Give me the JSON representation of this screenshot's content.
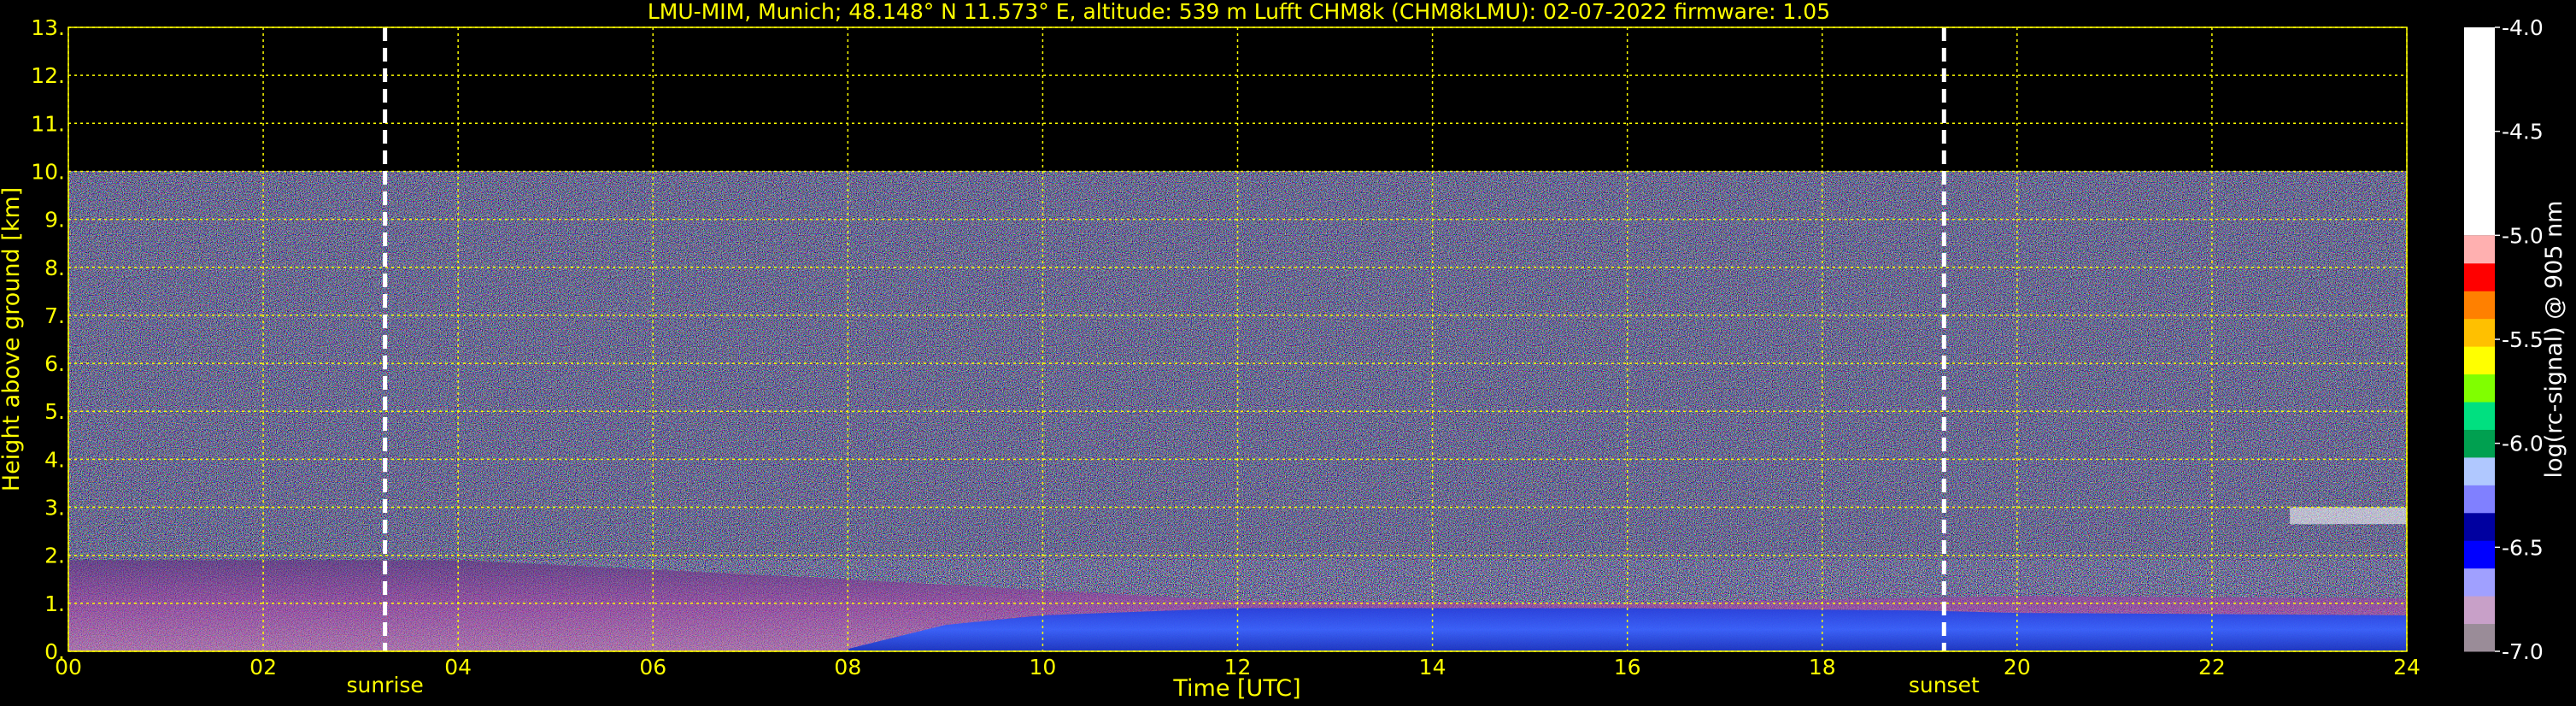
{
  "chart_data": {
    "type": "heatmap",
    "title": "LMU-MIM, Munich; 48.148° N 11.573° E, altitude: 539 m    Lufft CHM8k (CHM8kLMU): 02-07-2022    firmware: 1.05",
    "xlabel": "Time [UTC]",
    "ylabel": "Height above ground [km]",
    "xlim": [
      0,
      24
    ],
    "ylim": [
      0,
      13
    ],
    "x_ticks": [
      "00",
      "02",
      "04",
      "06",
      "08",
      "10",
      "12",
      "14",
      "16",
      "18",
      "20",
      "22",
      "24"
    ],
    "y_ticks": [
      "0.",
      "1.",
      "2.",
      "3.",
      "4.",
      "5.",
      "6.",
      "7.",
      "8.",
      "9.",
      "10.",
      "11.",
      "12.",
      "13."
    ],
    "grid": true,
    "data_top_km": 10,
    "events": [
      {
        "label": "sunrise",
        "time_utc": 3.25
      },
      {
        "label": "sunset",
        "time_utc": 19.25
      }
    ],
    "colorbar": {
      "label": "log(rc-signal) @ 905 nm",
      "range": [
        -7.0,
        -4.0
      ],
      "ticks": [
        "-4.0",
        "-4.5",
        "-5.0",
        "-5.5",
        "-6.0",
        "-6.5",
        "-7.0"
      ]
    },
    "layers": [
      {
        "name": "aerosol boundary layer (magenta/pink)",
        "top_km_start": 1.9,
        "top_km_mid": 1.0,
        "top_km_end": 1.1
      },
      {
        "name": "mixed layer (blue)",
        "from_utc": 8.0,
        "to_utc": 24,
        "top_km": 0.9
      },
      {
        "name": "cloud (white)",
        "from_utc": 22.8,
        "to_utc": 24,
        "height_km": 2.9
      }
    ]
  },
  "colors": {
    "background": "#000000",
    "text": "#ffff00",
    "grid": "#ffff00",
    "event_line": "#ffffff",
    "colorbar_text": "#ffffff",
    "colorbar_stops": [
      "#9a8c98",
      "#c8a0c8",
      "#a0a0ff",
      "#0000ff",
      "#0000a0",
      "#8080ff",
      "#b0c8ff",
      "#00a050",
      "#00e080",
      "#80ff00",
      "#ffff00",
      "#ffc000",
      "#ff8000",
      "#ff0000",
      "#ffb0b0",
      "#ffffff"
    ]
  }
}
